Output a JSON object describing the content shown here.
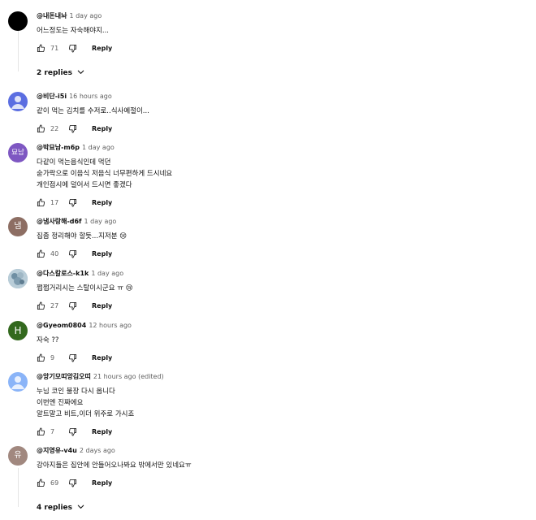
{
  "comments": [
    {
      "author": "@내돈내놔",
      "time": "1 day ago",
      "text": "어느정도는 자숙해야지...",
      "likes": "71",
      "reply_label": "Reply",
      "avatar_color": "#000000",
      "avatar_text": ""
    },
    {
      "author": "@비단-i5i",
      "time": "16 hours ago",
      "text": "같이 먹는 김치를 수저로..식사예절이...",
      "likes": "22",
      "reply_label": "Reply",
      "avatar_color": "#5b6ee1",
      "avatar_text": ""
    },
    {
      "author": "@박묘남-m6p",
      "time": "1 day ago",
      "text": "다같이 먹는음식인데 먹던\n숟가락으로 이음식 저음식 너무편하게 드시네요\n개인접시에 덜어서 드시면 좋겠다",
      "likes": "17",
      "reply_label": "Reply",
      "avatar_color": "#7e57c2",
      "avatar_text": "묘남"
    },
    {
      "author": "@냄사랑해-d6f",
      "time": "1 day ago",
      "text": "집좀 정리해야 할듯...지저분 😢",
      "likes": "40",
      "reply_label": "Reply",
      "avatar_color": "#8d6e63",
      "avatar_text": "냄"
    },
    {
      "author": "@다스칼로스-k1k",
      "time": "1 day ago",
      "text": "쩝쩝거리시는 스탈이시군요 ㅠ 😢",
      "likes": "27",
      "reply_label": "Reply",
      "avatar_color": "#7fa3b5",
      "avatar_text": ""
    },
    {
      "author": "@Gyeom0804",
      "time": "12 hours ago",
      "text": "자숙 ??",
      "likes": "9",
      "reply_label": "Reply",
      "avatar_color": "#33691e",
      "avatar_text": "H"
    },
    {
      "author": "@앙기모띠앙김오띠",
      "time": "21 hours ago (edited)",
      "text": "누님 코인 불장 다시 옵니다\n이번엔 진짜에요\n알트말고 비트,이더 위주로 가시죠",
      "likes": "7",
      "reply_label": "Reply",
      "avatar_color": "#8ab4f8",
      "avatar_text": ""
    },
    {
      "author": "@지영유-v4u",
      "time": "2 days ago",
      "text": "강아지들은 집안에 안들어오나봐요 밖에서만 있네요ㅠ",
      "likes": "69",
      "reply_label": "Reply",
      "avatar_color": "#a1887f",
      "avatar_text": "유"
    }
  ],
  "replies_toggles": [
    "2 replies",
    "4 replies"
  ]
}
